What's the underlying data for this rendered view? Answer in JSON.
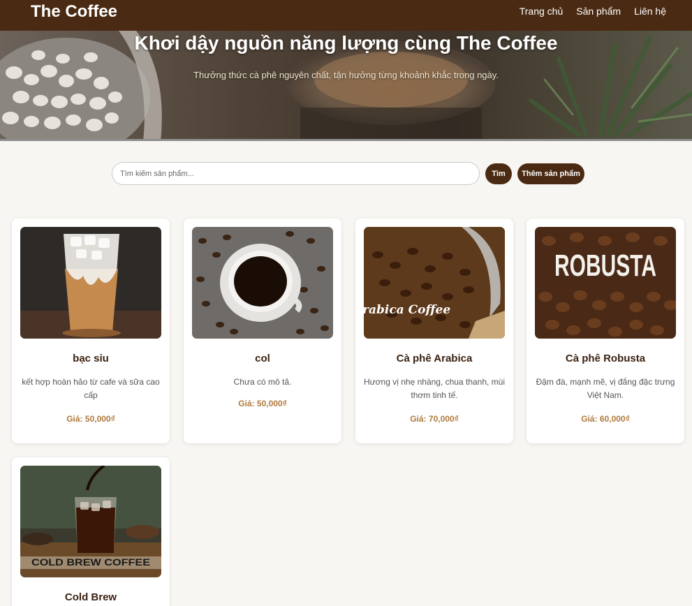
{
  "header": {
    "brand": "The Coffee",
    "nav": [
      "Trang chủ",
      "Sản phẩm",
      "Liên hệ"
    ]
  },
  "hero": {
    "title": "Khơi dậy nguồn năng lượng cùng The Coffee",
    "subtitle": "Thưởng thức cà phê nguyên chất, tận hưởng từng khoảnh khắc trong ngày."
  },
  "search": {
    "placeholder": "Tìm kiếm sản phẩm...",
    "value": "",
    "search_button": "Tìm",
    "add_button": "Thêm sản phẩm"
  },
  "products": [
    {
      "name": "bạc sỉu",
      "description": "kết hợp hoàn hảo từ cafe và sữa cao cấp",
      "price": "Giá: 50,000₫"
    },
    {
      "name": "col",
      "description": "Chưa có mô tả.",
      "price": "Giá: 50,000₫"
    },
    {
      "name": "Cà phê Arabica",
      "description": "Hương vị nhẹ nhàng, chua thanh, mùi thơm tinh tế.",
      "price": "Giá: 70,000₫",
      "image_text": "rabica Coffee"
    },
    {
      "name": "Cà phê Robusta",
      "description": "Đậm đà, mạnh mẽ, vị đắng đặc trưng Việt Nam.",
      "price": "Giá: 60,000₫",
      "image_text": "ROBUSTA"
    },
    {
      "name": "Cold Brew",
      "image_text": "COLD BREW COFFEE"
    }
  ]
}
